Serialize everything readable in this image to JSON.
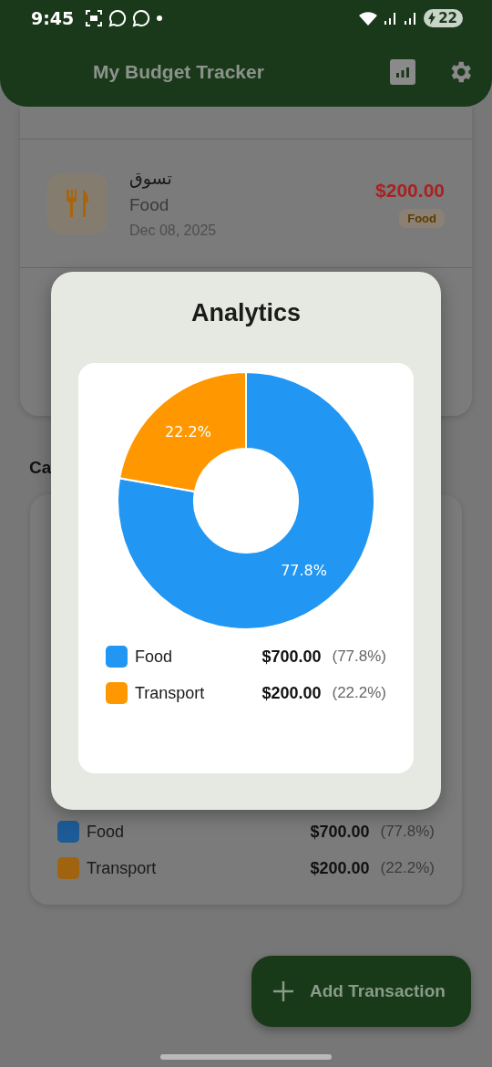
{
  "status_bar": {
    "time": "9:45",
    "battery": "22"
  },
  "app_bar": {
    "title": "My Budget Tracker"
  },
  "transactions": [
    {
      "title": "تسوق",
      "category": "Food",
      "date": "Dec 08, 2025",
      "amount": "$200.00",
      "tag": "Food"
    }
  ],
  "section_heading": "Ca",
  "category_legend": [
    {
      "name": "Food",
      "amount": "$700.00",
      "percent": "(77.8%)",
      "color": "#1d5b96"
    },
    {
      "name": "Transport",
      "amount": "$200.00",
      "percent": "(22.2%)",
      "color": "#a06410"
    }
  ],
  "dialog": {
    "title": "Analytics",
    "chart_data": {
      "type": "donut",
      "categories": [
        "Food",
        "Transport"
      ],
      "values": [
        77.8,
        22.2
      ],
      "data_labels": true,
      "value_labels": [
        "77.8%",
        "22.2%"
      ]
    },
    "legend": [
      {
        "amount": "$700.00",
        "percent": "(77.8%)",
        "color": "#2196f3"
      },
      {
        "amount": "$200.00",
        "percent": "(22.2%)",
        "color": "#ff9800"
      }
    ]
  },
  "fab": {
    "label": "Add Transaction"
  }
}
